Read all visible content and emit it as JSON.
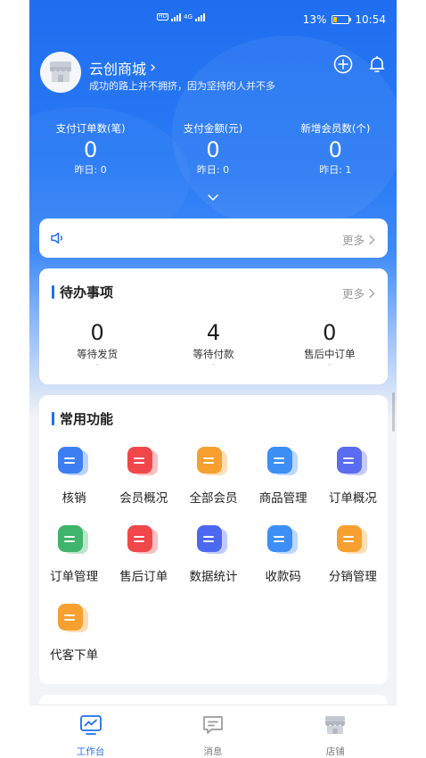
{
  "status_bar": {
    "network_badge": "HD",
    "signal_1": "4G",
    "battery": "13%",
    "time": "10:54"
  },
  "store": {
    "name": "云创商城",
    "slogan": "成功的路上并不拥挤，因为坚持的人并不多",
    "chevron": "›"
  },
  "stats": [
    {
      "label": "支付订单数(笔)",
      "value": "0",
      "yesterday": "昨日: 0"
    },
    {
      "label": "支付金额(元)",
      "value": "0",
      "yesterday": "昨日: 0"
    },
    {
      "label": "新增会员数(个)",
      "value": "0",
      "yesterday": "昨日: 1"
    }
  ],
  "notice": {
    "more": "更多"
  },
  "todo": {
    "title": "待办事项",
    "more": "更多",
    "items": [
      {
        "count": "0",
        "name": "等待发货",
        "sub": "-"
      },
      {
        "count": "4",
        "name": "等待付款",
        "sub": "-"
      },
      {
        "count": "0",
        "name": "售后中订单",
        "sub": "-"
      }
    ]
  },
  "functions": {
    "title": "常用功能",
    "items": [
      {
        "name": "核销",
        "icon": "verify-icon",
        "color": "#3d7ff2"
      },
      {
        "name": "会员概况",
        "icon": "member-overview-icon",
        "color": "#f0474b"
      },
      {
        "name": "全部会员",
        "icon": "all-members-icon",
        "color": "#f6a030"
      },
      {
        "name": "商品管理",
        "icon": "cart-icon",
        "color": "#3d8ef5"
      },
      {
        "name": "订单概况",
        "icon": "order-overview-icon",
        "color": "#5a6cf0"
      },
      {
        "name": "订单管理",
        "icon": "order-manage-icon",
        "color": "#3fb46b"
      },
      {
        "name": "售后订单",
        "icon": "after-sale-icon",
        "color": "#f0474b"
      },
      {
        "name": "数据统计",
        "icon": "chart-icon",
        "color": "#4c68f0"
      },
      {
        "name": "收款码",
        "icon": "payment-code-icon",
        "color": "#3d8ef5"
      },
      {
        "name": "分销管理",
        "icon": "distribution-icon",
        "color": "#f6a030"
      },
      {
        "name": "代客下单",
        "icon": "proxy-order-icon",
        "color": "#f6a030"
      }
    ]
  },
  "tabbar": {
    "items": [
      {
        "label": "工作台",
        "icon": "workbench-icon",
        "active": true
      },
      {
        "label": "消息",
        "icon": "message-icon",
        "active": false
      },
      {
        "label": "店铺",
        "icon": "store-icon",
        "active": false
      }
    ]
  },
  "colors": {
    "primary": "#1f6ef0",
    "background": "#f3f4f6"
  }
}
